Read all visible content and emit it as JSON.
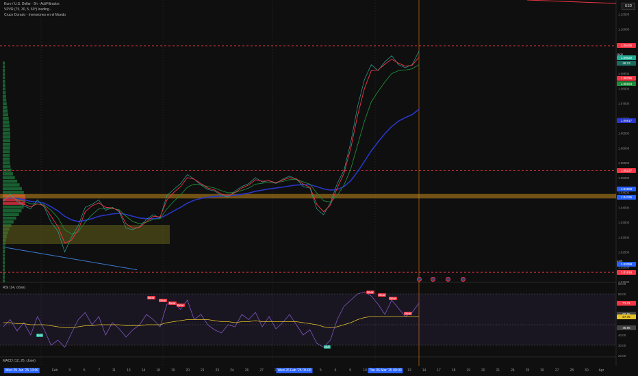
{
  "header": {
    "symbol_line": "Euro / U.S. Dollar · 5h · ActiFiltrados",
    "indicator_line_1": "VPVR (75, 30, 5, 60°) loading...",
    "indicator_line_2": "Cruce Dorado - Inversiones en el Mundo"
  },
  "currency_button": "USD",
  "panes": {
    "rsi_title": "RSI (14, close)",
    "macd_title": "MACD (12, 26, close)"
  },
  "price_axis": {
    "ticks": [
      "1.10500",
      "1.10000",
      "1.09500",
      "1.09000",
      "1.08500",
      "1.08000",
      "1.07500",
      "1.07000",
      "1.06500",
      "1.06000",
      "1.05500",
      "1.05000",
      "1.04500",
      "1.04000",
      "1.03500",
      "1.03000",
      "1.02500",
      "1.02000",
      "1.01500"
    ],
    "tags": [
      {
        "text": "1.09436",
        "color": "#f23645"
      },
      {
        "text": "1.09029",
        "color": "#22ab94"
      },
      {
        "text": "1.08336",
        "color": "#f23645"
      },
      {
        "text": "1.08154",
        "color": "#1e8a3a"
      },
      {
        "text": "1.06917",
        "color": "#2837c9"
      },
      {
        "text": "1.05237",
        "color": "#f23645"
      },
      {
        "text": "1.04609",
        "color": "#2962ff"
      },
      {
        "text": "1.04335",
        "color": "#2962ff"
      },
      {
        "text": "1.02098",
        "color": "#2962ff"
      },
      {
        "text": "1.01818",
        "color": "#f23645"
      }
    ],
    "high_label": "High",
    "low_label": "Low",
    "countdown": "46:13"
  },
  "rsi_axis": {
    "ticks": [
      "90.00",
      "80.00",
      "60.00",
      "40.00",
      "30.00",
      "20.00"
    ],
    "tags": [
      {
        "text": "71.21",
        "color": "#f23645"
      },
      {
        "text": "60.55",
        "color": "#444444"
      },
      {
        "text": "57.75",
        "color": "#e6c229"
      },
      {
        "text": "46.96",
        "color": "#444444"
      }
    ]
  },
  "time_axis": {
    "labels": [
      "Feb",
      "3",
      "5",
      "7",
      "11",
      "13",
      "14",
      "18",
      "19",
      "20",
      "21",
      "23",
      "24",
      "26",
      "27",
      "28",
      "Mar",
      "4",
      "5",
      "6",
      "9",
      "10",
      "11",
      "12",
      "13",
      "14",
      "17",
      "18",
      "19",
      "20",
      "21",
      "24",
      "25",
      "26",
      "27",
      "28",
      "30",
      "Apr"
    ],
    "highlights": [
      "Wed 29 Jan '25  13:00",
      "Wed 26 Feb '25  05:00",
      "Thu 06 Mar '25  00:00"
    ]
  },
  "signals": {
    "sell_label": "Bear",
    "buy_label": "Bull"
  },
  "chart_data": {
    "type": "line",
    "title": "Euro / U.S. Dollar",
    "xlabel": "",
    "ylabel": "",
    "ylim": [
      1.015,
      1.107
    ],
    "series": [
      {
        "name": "",
        "x": [
          0,
          10,
          20,
          30,
          40,
          50,
          60,
          70,
          80,
          90,
          100,
          110,
          120,
          130,
          140,
          150,
          160,
          170,
          180,
          190,
          200,
          210,
          220,
          230,
          240,
          250,
          260,
          270,
          280,
          290,
          300,
          310,
          320,
          330,
          340,
          350,
          360,
          370,
          380,
          390,
          400,
          410,
          420,
          430,
          440,
          450,
          460,
          470,
          480,
          490,
          500,
          510,
          520,
          530,
          540,
          550,
          560,
          570,
          580,
          590,
          600,
          610
        ],
        "values": [
          1.042,
          1.0445,
          1.042,
          1.0405,
          1.0395,
          1.0425,
          1.04,
          1.035,
          1.032,
          1.025,
          1.03,
          1.034,
          1.04,
          1.041,
          1.0425,
          1.039,
          1.04,
          1.0385,
          1.033,
          1.0325,
          1.0335,
          1.036,
          1.0375,
          1.0365,
          1.044,
          1.046,
          1.048,
          1.051,
          1.0495,
          1.0475,
          1.046,
          1.0455,
          1.044,
          1.0435,
          1.0455,
          1.047,
          1.048,
          1.05,
          1.0485,
          1.049,
          1.048,
          1.0495,
          1.0505,
          1.0495,
          1.047,
          1.0465,
          1.0395,
          1.0375,
          1.0415,
          1.048,
          1.0525,
          1.062,
          1.074,
          1.083,
          1.088,
          1.086,
          1.089,
          1.091,
          1.088,
          1.087,
          1.088,
          1.0925
        ]
      }
    ],
    "ema_fast": [
      1.0425,
      1.0435,
      1.0425,
      1.041,
      1.0402,
      1.0412,
      1.0405,
      1.037,
      1.0335,
      1.028,
      1.029,
      1.0325,
      1.0385,
      1.0405,
      1.0415,
      1.04,
      1.0398,
      1.0388,
      1.0345,
      1.033,
      1.0333,
      1.0352,
      1.037,
      1.0368,
      1.0425,
      1.045,
      1.047,
      1.05,
      1.0495,
      1.048,
      1.0465,
      1.0458,
      1.0445,
      1.0438,
      1.045,
      1.0465,
      1.0475,
      1.0493,
      1.0488,
      1.0489,
      1.0483,
      1.0492,
      1.05,
      1.0496,
      1.0478,
      1.0468,
      1.041,
      1.0385,
      1.0408,
      1.0465,
      1.0515,
      1.06,
      1.071,
      1.08,
      1.086,
      1.0862,
      1.0882,
      1.0898,
      1.0885,
      1.0875,
      1.0878,
      1.0905
    ],
    "ema_mid": [
      1.043,
      1.0432,
      1.0428,
      1.042,
      1.0412,
      1.0412,
      1.0408,
      1.039,
      1.0365,
      1.0325,
      1.031,
      1.0318,
      1.035,
      1.0375,
      1.0395,
      1.0395,
      1.0396,
      1.0392,
      1.037,
      1.0352,
      1.0345,
      1.035,
      1.036,
      1.0362,
      1.0395,
      1.042,
      1.0442,
      1.0468,
      1.0478,
      1.0476,
      1.047,
      1.0465,
      1.0456,
      1.0449,
      1.045,
      1.0457,
      1.0465,
      1.0478,
      1.0481,
      1.0484,
      1.0483,
      1.0487,
      1.0493,
      1.0494,
      1.0486,
      1.0478,
      1.0448,
      1.0422,
      1.0418,
      1.044,
      1.0475,
      1.053,
      1.061,
      1.069,
      1.0755,
      1.079,
      1.0822,
      1.085,
      1.086,
      1.0862,
      1.0866,
      1.088
    ],
    "ema_slow": [
      1.043,
      1.0432,
      1.043,
      1.0426,
      1.042,
      1.0418,
      1.0414,
      1.0402,
      1.0388,
      1.037,
      1.0358,
      1.0352,
      1.0356,
      1.0362,
      1.037,
      1.0374,
      1.0378,
      1.038,
      1.0376,
      1.037,
      1.0364,
      1.0362,
      1.0362,
      1.0364,
      1.0375,
      1.0388,
      1.04,
      1.0414,
      1.0424,
      1.043,
      1.0434,
      1.0437,
      1.0438,
      1.0439,
      1.0441,
      1.0444,
      1.0448,
      1.0454,
      1.0458,
      1.0462,
      1.0465,
      1.0468,
      1.0472,
      1.0475,
      1.0476,
      1.0476,
      1.047,
      1.0462,
      1.0458,
      1.046,
      1.047,
      1.049,
      1.052,
      1.0555,
      1.059,
      1.062,
      1.0648,
      1.0672,
      1.069,
      1.0702,
      1.0712,
      1.073
    ],
    "levels": [
      1.09436,
      1.05237,
      1.01818
    ],
    "zone": [
      1.043,
      1.0445
    ],
    "rsi": {
      "ylim": [
        20,
        90
      ],
      "overbought": 80,
      "oversold": 30,
      "x": [
        0,
        10,
        20,
        30,
        40,
        50,
        60,
        70,
        80,
        90,
        100,
        110,
        120,
        130,
        140,
        150,
        160,
        170,
        180,
        190,
        200,
        210,
        220,
        230,
        240,
        250,
        260,
        270,
        280,
        290,
        300,
        310,
        320,
        330,
        340,
        350,
        360,
        370,
        380,
        390,
        400,
        410,
        420,
        430,
        440,
        450,
        460,
        470,
        480,
        490,
        500,
        510,
        520,
        530,
        540,
        550,
        560,
        570,
        580,
        590,
        600,
        610
      ],
      "values": [
        48,
        55,
        44,
        52,
        40,
        58,
        45,
        30,
        35,
        28,
        42,
        55,
        62,
        50,
        58,
        40,
        52,
        46,
        38,
        45,
        50,
        60,
        55,
        48,
        70,
        72,
        65,
        74,
        55,
        60,
        50,
        45,
        42,
        50,
        48,
        60,
        55,
        62,
        48,
        58,
        46,
        52,
        60,
        50,
        40,
        45,
        32,
        28,
        35,
        55,
        68,
        74,
        80,
        82,
        78,
        70,
        60,
        74,
        66,
        58,
        62,
        71
      ],
      "ma": [
        52,
        52,
        51,
        51,
        50,
        50,
        50,
        49,
        48,
        47,
        47,
        48,
        49,
        49,
        50,
        50,
        50,
        50,
        49,
        49,
        49,
        50,
        50,
        50,
        52,
        53,
        54,
        55,
        55,
        55,
        55,
        54,
        53,
        53,
        52,
        53,
        53,
        54,
        53,
        53,
        53,
        53,
        53,
        53,
        52,
        51,
        50,
        48,
        47,
        48,
        50,
        52,
        55,
        57,
        58,
        58,
        58,
        58,
        58,
        58,
        58,
        58
      ]
    }
  }
}
